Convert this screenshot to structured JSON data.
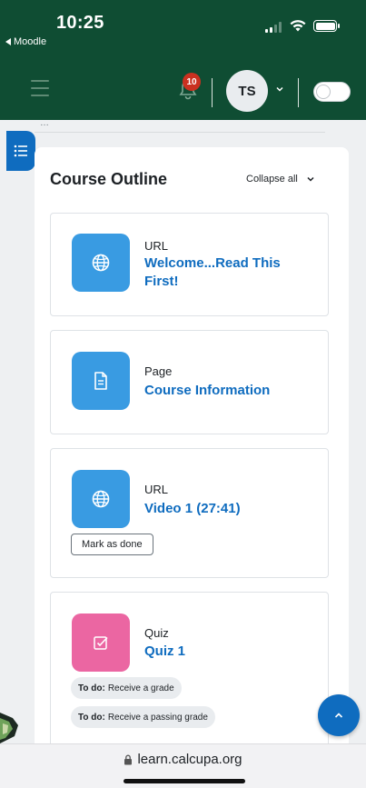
{
  "status_bar": {
    "time": "10:25",
    "back_app": "Moodle"
  },
  "header": {
    "notification_count": "10",
    "user_initials": "TS"
  },
  "course": {
    "outline_title": "Course Outline",
    "collapse_all": "Collapse all"
  },
  "activities": [
    {
      "type": "URL",
      "name": "Welcome...Read This First!",
      "icon": "globe-icon"
    },
    {
      "type": "Page",
      "name": "Course Information",
      "icon": "document-icon"
    },
    {
      "type": "URL",
      "name": "Video 1 (27:41)",
      "icon": "globe-icon",
      "button": "Mark as done"
    },
    {
      "type": "Quiz",
      "name": "Quiz 1",
      "icon": "quiz-check-icon",
      "todos": [
        {
          "prefix": "To do:",
          "text": "Receive a grade"
        },
        {
          "prefix": "To do:",
          "text": "Receive a passing grade"
        }
      ]
    }
  ],
  "browser": {
    "url": "learn.calcupa.org"
  },
  "colors": {
    "header_bg": "#0f4d33",
    "link_blue": "#0f6cbf",
    "url_icon_bg": "#399be2",
    "quiz_icon_bg": "#eb66a2",
    "badge_red": "#ca3120"
  }
}
